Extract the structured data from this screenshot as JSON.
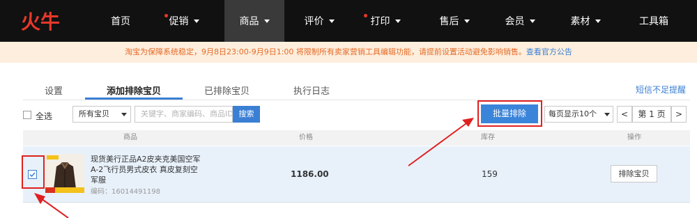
{
  "nav": {
    "logo": "火牛",
    "items": [
      {
        "label": "首页",
        "dropdown": false,
        "dot": false,
        "active": false
      },
      {
        "label": "促销",
        "dropdown": true,
        "dot": true,
        "active": false
      },
      {
        "label": "商品",
        "dropdown": true,
        "dot": false,
        "active": true
      },
      {
        "label": "评价",
        "dropdown": true,
        "dot": false,
        "active": false
      },
      {
        "label": "打印",
        "dropdown": true,
        "dot": true,
        "active": false
      },
      {
        "label": "售后",
        "dropdown": true,
        "dot": false,
        "active": false
      },
      {
        "label": "会员",
        "dropdown": true,
        "dot": false,
        "active": false
      },
      {
        "label": "素材",
        "dropdown": true,
        "dot": false,
        "active": false
      },
      {
        "label": "工具箱",
        "dropdown": false,
        "dot": false,
        "active": false
      }
    ]
  },
  "notice": {
    "text": "淘宝为保障系统稳定，9月8日23:00-9月9日1:00 将限制所有卖家营销工具编辑功能，请提前设置活动避免影响销售。",
    "link": "查看官方公告"
  },
  "tabs": [
    {
      "label": "设置",
      "active": false
    },
    {
      "label": "添加排除宝贝",
      "active": true
    },
    {
      "label": "已排除宝贝",
      "active": false
    },
    {
      "label": "执行日志",
      "active": false
    }
  ],
  "sms_link": "短信不足提醒",
  "toolbar": {
    "select_all": "全选",
    "filter_select": "所有宝贝",
    "search_placeholder": "关键字、商家编码、商品ID",
    "search_button": "搜索",
    "batch_button": "批量排除",
    "per_page": "每页显示10个",
    "page_label": "第 1 页",
    "prev": "<",
    "next": ">"
  },
  "table": {
    "headers": [
      "商品",
      "价格",
      "库存",
      "操作"
    ],
    "rows": [
      {
        "title": "现货美行正品A2皮夹克美国空军A-2飞行员男式皮衣 真皮复刻空军服",
        "code": "编码：16014491198",
        "price": "1186.00",
        "stock": "159",
        "action": "排除宝贝",
        "checked": true
      }
    ]
  },
  "colors": {
    "accent": "#3a7fd4",
    "nav_bg": "#111111",
    "notice_bg": "#fdeedd",
    "notice_text": "#e46b28",
    "highlight_red": "#e02020",
    "logo_red": "#e8382a"
  }
}
